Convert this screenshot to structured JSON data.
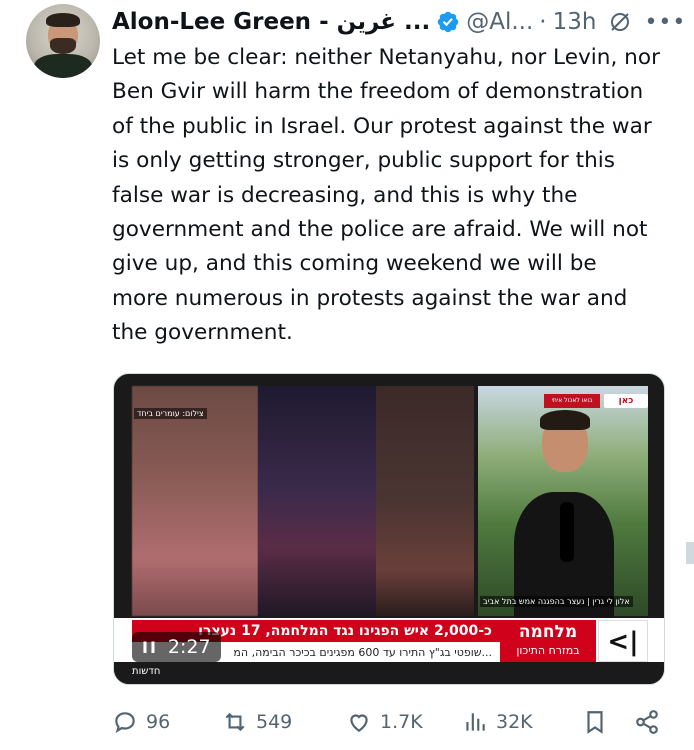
{
  "author": {
    "display_name": "Alon-Lee Green - غرين ...",
    "handle": "@Al...",
    "separator": "·",
    "time": "13h",
    "verified_color": "#1d9bf0"
  },
  "tweet": {
    "text": "Let me be clear: neither Netanyahu, nor Levin, nor\nBen Gvir will harm the freedom of demonstration\nof the public in Israel. Our protest against the war\nis only getting stronger, public support for this\nfalse war is decreasing, and this is why the\ngovernment and the police are afraid. We will not\ngive up, and this coming weekend we will be\nmore numerous in protests against the war and\nthe government."
  },
  "video": {
    "duration": "2:27",
    "pause_glyph": "II",
    "caption_left": "צילום: עומרים ביחד",
    "caption_right": "אלון לי גרין | נעצר בהפגנה אמש בתל אביב",
    "headline": "כ-2,000 איש הפגינו נגד המלחמה, 17 נעצרו",
    "subline": "שופטי בג\"ץ התירו עד 600 מפגינים בכיכר הבימה, המ...",
    "war_label": "מלחמה",
    "war_sub": "במזרח התיכון",
    "channel": "<|",
    "channel_logo": "כאן",
    "bottom_label": "חדשות",
    "news_tag": "בואו לאכול איתי"
  },
  "actions": {
    "replies": "96",
    "reposts": "549",
    "likes": "1.7K",
    "views": "32K"
  },
  "colors": {
    "text": "#0f1419",
    "secondary": "#536471",
    "accent": "#1d9bf0",
    "news_red": "#d0021b"
  },
  "icons": [
    "verified-badge-icon",
    "grok-icon",
    "more-icon",
    "reply-icon",
    "repost-icon",
    "like-icon",
    "views-icon",
    "bookmark-icon",
    "share-icon",
    "pause-icon"
  ]
}
